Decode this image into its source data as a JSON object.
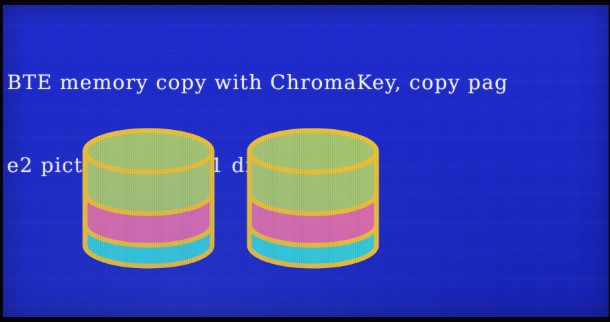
{
  "screen": {
    "background_color": "#1a27c8",
    "text_color": "#f4f4f8",
    "message_lines": [
      "BTE memory copy with ChromaKey, copy pag",
      "e2 picture to page1 display"
    ]
  },
  "graphic": {
    "name": "database-stack-icon",
    "copies": 2,
    "colors": {
      "outline": "#f2c22a",
      "top_layer": "#a8c86a",
      "middle_layer": "#e06aa6",
      "bottom_layer": "#2fcfd6"
    }
  }
}
